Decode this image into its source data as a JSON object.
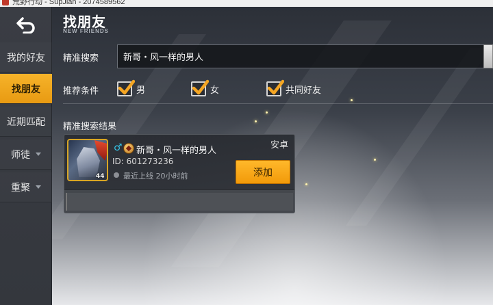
{
  "window": {
    "title": "荒野行动 - SupJian - 2074589562"
  },
  "sidebar": {
    "items": [
      {
        "label": "我的好友",
        "active": false,
        "has_caret": false
      },
      {
        "label": "找朋友",
        "active": true,
        "has_caret": false
      },
      {
        "label": "近期匹配",
        "active": false,
        "has_caret": false
      },
      {
        "label": "师徒",
        "active": false,
        "has_caret": true
      },
      {
        "label": "重聚",
        "active": false,
        "has_caret": true
      }
    ]
  },
  "header": {
    "title": "找朋友",
    "subtitle": "NEW FRIENDS"
  },
  "search": {
    "label": "精准搜索",
    "value": "新哥・风一样的男人"
  },
  "filters": {
    "label": "推荐条件",
    "options": [
      {
        "label": "男",
        "checked": true
      },
      {
        "label": "女",
        "checked": true
      },
      {
        "label": "共同好友",
        "checked": true
      }
    ]
  },
  "results": {
    "label": "精准搜索结果",
    "items": [
      {
        "name": "新哥・风一样的男人",
        "gender_icon": "male-icon",
        "rank_icon": "rank-medal-icon",
        "platform": "安卓",
        "id_text": "ID: 601273236",
        "level": "44",
        "status_text": "最近上线 20小时前",
        "action_label": "添加"
      }
    ]
  },
  "colors": {
    "accent": "#f5a623",
    "male": "#34c6ea"
  }
}
